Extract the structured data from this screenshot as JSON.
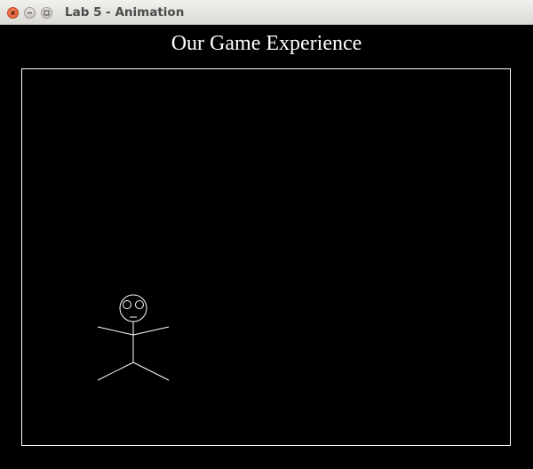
{
  "window": {
    "title": "Lab 5 - Animation",
    "controls": {
      "close": "close-icon",
      "minimize": "minimize-icon",
      "maximize": "maximize-icon"
    }
  },
  "game": {
    "title": "Our Game Experience",
    "colors": {
      "background": "#000000",
      "foreground": "#ffffff"
    },
    "player": {
      "sprite": "stick-figure"
    }
  }
}
